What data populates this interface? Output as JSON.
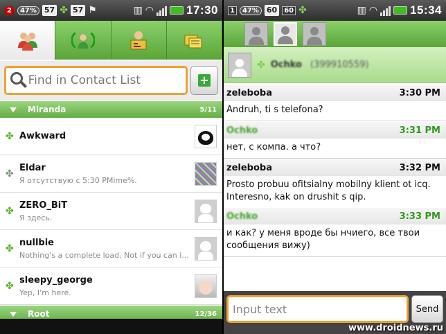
{
  "left": {
    "status": {
      "notif_count": "2",
      "battery_pct": "47%",
      "box1": "57",
      "box2": "57",
      "time": "17:30"
    },
    "search": {
      "placeholder": "Find in Contact List"
    },
    "groups": [
      {
        "name": "Miranda",
        "count": "5/11"
      },
      {
        "name": "Root",
        "count": "12/36"
      }
    ],
    "contacts": [
      {
        "name": "Awkward",
        "status_text": ""
      },
      {
        "name": "Eldar",
        "status_text": "Я отсутствую с 5:30 PMime%."
      },
      {
        "name": "ZERO_BiT",
        "status_text": "Я здесь."
      },
      {
        "name": "nullbie",
        "status_text": "Nothing's a complete load. Not if you can i..."
      },
      {
        "name": "sleepy_george",
        "status_text": "Yep, I'm here."
      }
    ]
  },
  "right": {
    "status": {
      "box_left": "1",
      "battery_pct": "47%",
      "box1": "60",
      "box2": "60",
      "time": "15:34"
    },
    "header": {
      "name": "Ochko",
      "uin": "(399910559)"
    },
    "messages": [
      {
        "sender": "zeleboba",
        "time": "3:30 PM",
        "text": "Andruh, ti s telefona?",
        "mine": false
      },
      {
        "sender": "Ochko",
        "time": "3:31 PM",
        "text": "нет, с компа. а что?",
        "mine": true
      },
      {
        "sender": "zeleboba",
        "time": "3:32 PM",
        "text": "Prosto probuu ofitsialny mobilny klient ot icq. Interesno, kak on drushit s qip.",
        "mine": false
      },
      {
        "sender": "Ochko",
        "time": "3:33 PM",
        "text": "и как? у меня вроде бы нчиего, все твои сообщения вижу)",
        "mine": true
      }
    ],
    "input": {
      "placeholder": "Input text",
      "send_label": "Send"
    }
  },
  "watermark": "www.droidnews.ru"
}
